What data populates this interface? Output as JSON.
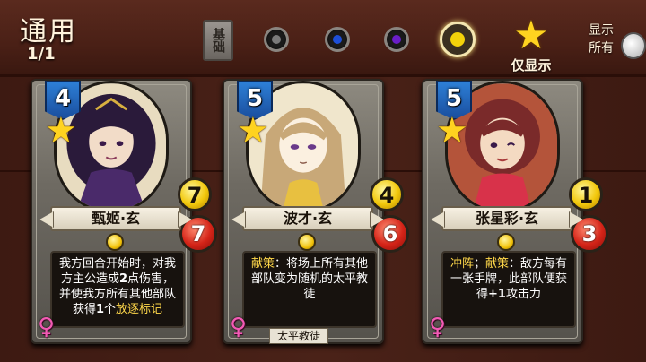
{
  "header": {
    "title": "通用",
    "page": "1/1",
    "basic_label": "基础",
    "gems": [
      {
        "name": "gem-gray",
        "color": "#7a7a7a"
      },
      {
        "name": "gem-blue",
        "color": "#1e4fd8"
      },
      {
        "name": "gem-purple",
        "color": "#6a1ec8"
      },
      {
        "name": "gem-gold",
        "color": "#f2d20a"
      }
    ],
    "star_filter_label": "仅显示",
    "show_all_line1": "显示",
    "show_all_line2": "所有"
  },
  "cards": [
    {
      "name": "甄姬·玄",
      "cost": "4",
      "attack": "7",
      "health": "7",
      "text_parts": [
        "我方回合开始时，对我方主公造成",
        "2",
        "点伤害，并使我方所有其他部队获得",
        "1",
        "个",
        "放逐标记"
      ],
      "tribe": "",
      "gender_icon": "female-icon",
      "portrait_colors": {
        "hair": "#2a1a3a",
        "skin": "#f2dcc8",
        "bg": "#e8dcc0",
        "cloth": "#4a2a6a"
      }
    },
    {
      "name": "波才·玄",
      "cost": "5",
      "attack": "4",
      "health": "6",
      "text_parts": [
        "献策",
        "：将场上所有其他部队变为随机的太平教徒"
      ],
      "tribe": "太平教徒",
      "gender_icon": "female-icon",
      "portrait_colors": {
        "hair": "#c8a878",
        "skin": "#fbf0e0",
        "bg": "#f0e6cc",
        "cloth": "#e8c040"
      }
    },
    {
      "name": "张星彩·玄",
      "cost": "5",
      "attack": "1",
      "health": "3",
      "text_parts": [
        "冲阵",
        "；",
        "献策",
        "：敌方每有一张手牌，此部队便获得",
        "+1",
        "攻击力"
      ],
      "tribe": "",
      "gender_icon": "female-icon",
      "portrait_colors": {
        "hair": "#7a2a2a",
        "skin": "#f4dac2",
        "bg": "#b4543a",
        "cloth": "#d8324a"
      }
    }
  ],
  "colors": {
    "keyword": "#ffd84a",
    "cost_blue": "#2d7fd6",
    "attack_gold": "#f2c80c",
    "health_red": "#d42418",
    "female_pink": "#f25ab4"
  }
}
